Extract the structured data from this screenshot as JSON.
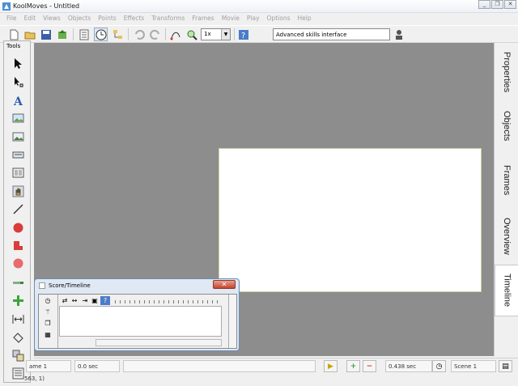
{
  "window": {
    "title": "KoolMoves - Untitled",
    "controls": [
      "_",
      "❐",
      "✕"
    ]
  },
  "menu": [
    "File",
    "Edit",
    "Views",
    "Objects",
    "Points",
    "Effects",
    "Transforms",
    "Frames",
    "Movie",
    "Play",
    "Options",
    "Help"
  ],
  "toolbar": {
    "zoom_value": "1x",
    "mode_label": "Advanced skills interface",
    "icons": [
      "new-icon",
      "open-icon",
      "save-icon",
      "export-icon",
      "properties-icon",
      "timer-icon",
      "tree-icon",
      "undo-icon",
      "redo-icon",
      "bezier-icon",
      "zoom-icon",
      "help-icon",
      "user-icon"
    ]
  },
  "tools_panel": {
    "title": "Tools"
  },
  "right_tabs": [
    "Properties",
    "Objects",
    "Frames",
    "Overview",
    "Timeline"
  ],
  "timeline_window": {
    "title": "Score/Timeline",
    "close": "✕"
  },
  "status": {
    "scene_label": "ame 1",
    "time_start": "0.0 sec",
    "time_end": "0.438 sec",
    "scene_name": "Scene 1",
    "coords": "563, 1)"
  },
  "colors": {
    "stage": "#8d8d8d",
    "canvas": "#ffffff",
    "close_red": "#c7432c",
    "play_yellow": "#e0b800",
    "add_green": "#3aa53a",
    "remove_red": "#d23b3b"
  }
}
